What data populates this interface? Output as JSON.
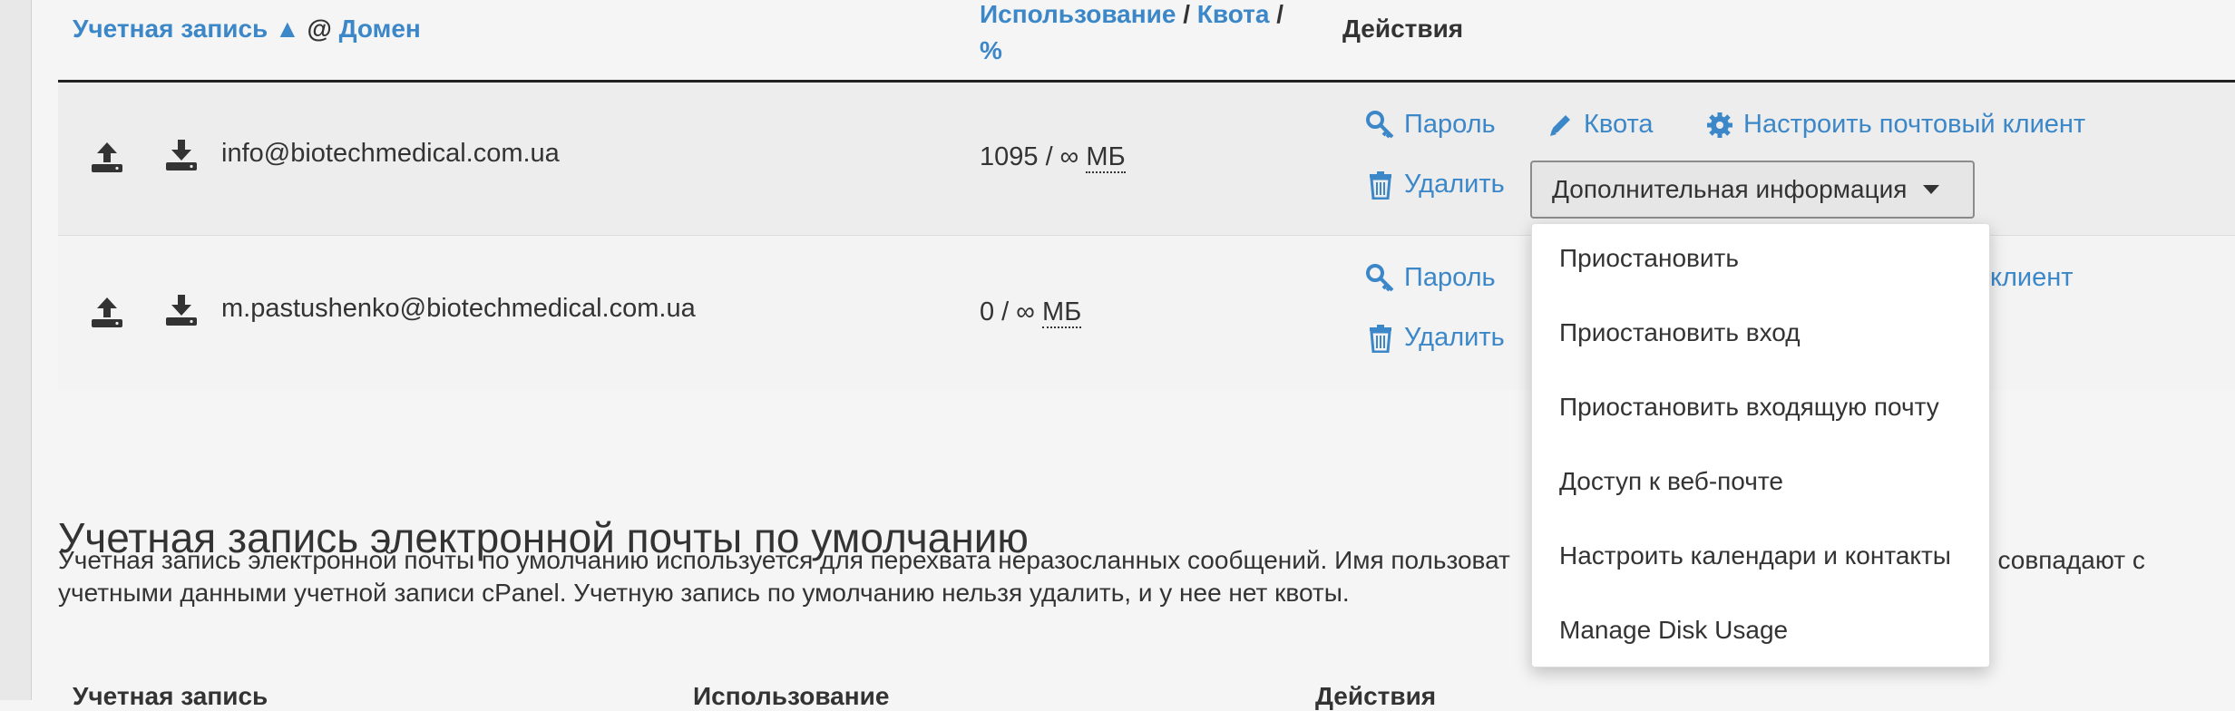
{
  "table": {
    "headers": {
      "account": "Учетная запись",
      "sort_arrow": "▲",
      "at": "@",
      "domain": "Домен",
      "usage": "Использование",
      "slash1": "/",
      "quota": "Квота",
      "slash2": "/",
      "percent": "%",
      "actions": "Действия"
    },
    "rows": [
      {
        "email": "info@biotechmedical.com.ua",
        "usage_value": "1095 / ∞",
        "usage_unit": "МБ"
      },
      {
        "email": "m.pastushenko@biotechmedical.com.ua",
        "usage_value": "0 / ∞",
        "usage_unit": "МБ"
      }
    ],
    "actions": {
      "password": "Пароль",
      "quota": "Квота",
      "configure_client": "Настроить почтовый клиент",
      "configure_client_partial": "клиент",
      "delete": "Удалить",
      "more_info": "Дополнительная информация"
    }
  },
  "dropdown": {
    "items": [
      "Приостановить",
      "Приостановить вход",
      "Приостановить входящую почту",
      "Доступ к веб-почте",
      "Настроить календари и контакты",
      "Manage Disk Usage"
    ]
  },
  "default_section": {
    "title": "Учетная запись электронной почты по умолчанию",
    "desc_line1_a": "Учетная запись электронной почты по умолчанию используется для перехвата неразосланных сообщений. Имя пользоват",
    "desc_line1_b": "анию совпадают с",
    "desc_line2": "учетными данными учетной записи cPanel. Учетную запись по умолчанию нельзя удалить, и у нее нет квоты.",
    "col_account": "Учетная запись",
    "col_usage": "Использование",
    "col_actions": "Действия"
  },
  "colors": {
    "link": "#3b87c8",
    "text": "#333333",
    "row_bg": "#ededed"
  }
}
